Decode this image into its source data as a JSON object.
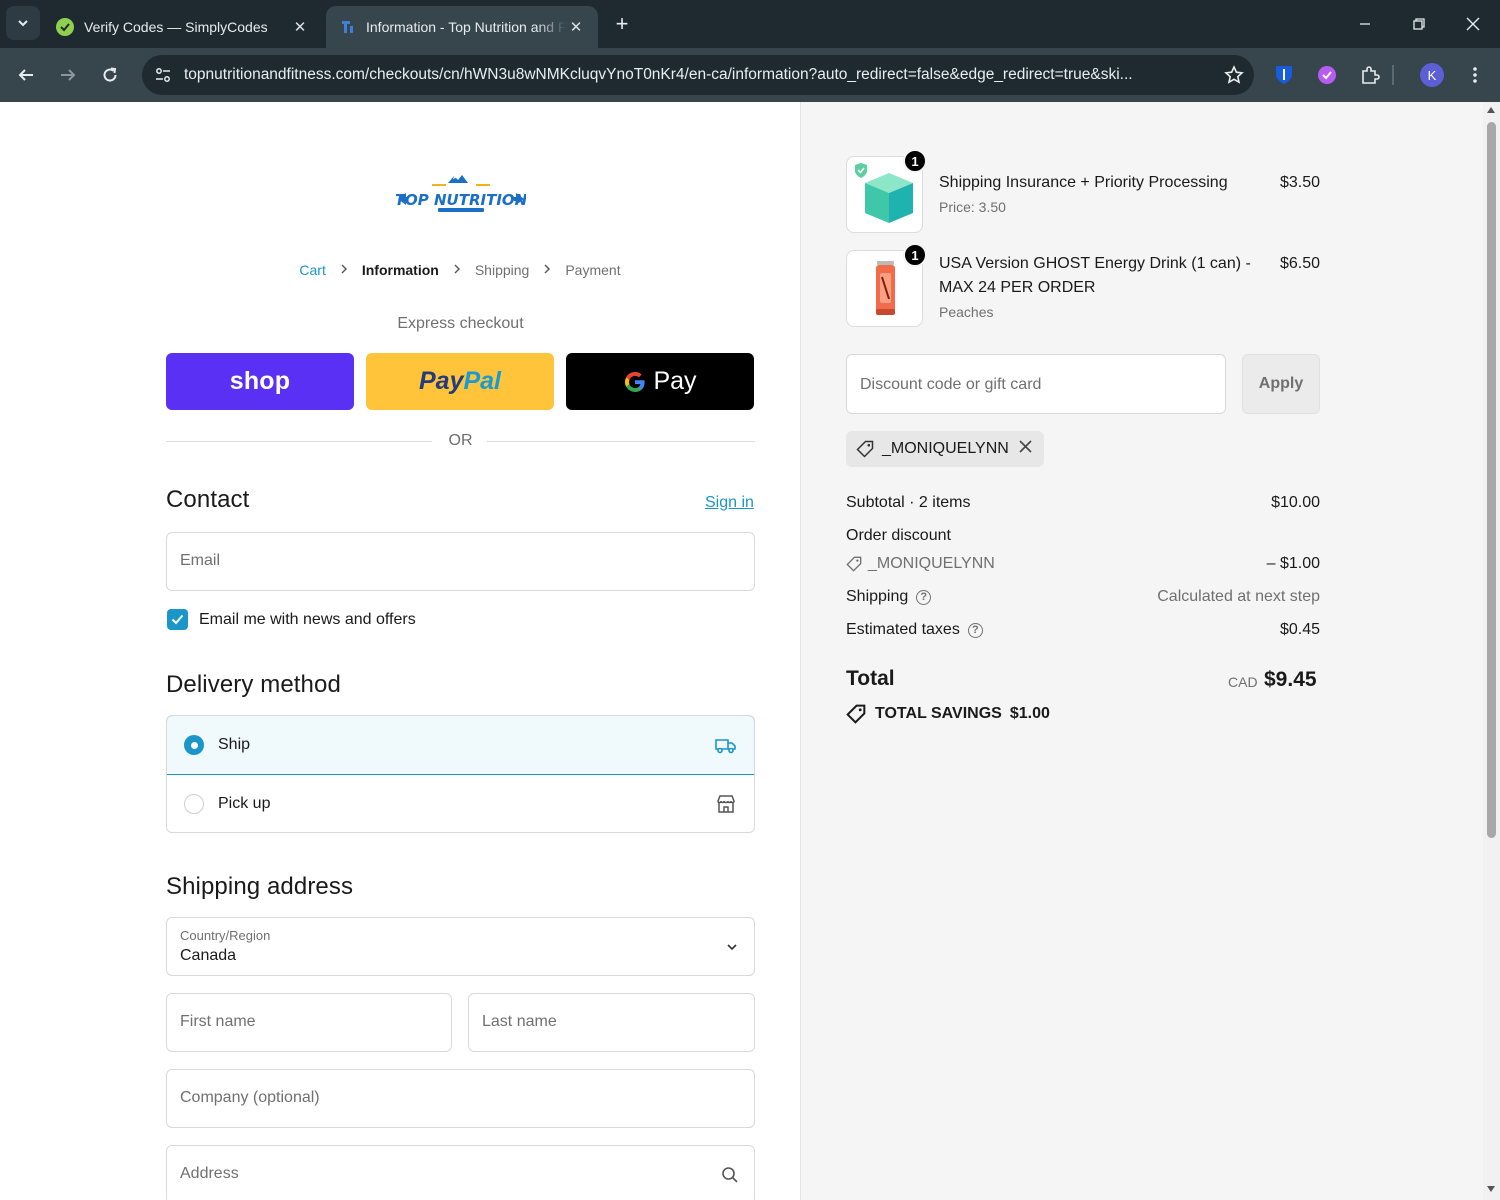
{
  "browser": {
    "tabs": [
      {
        "title": "Verify Codes — SimplyCodes",
        "active": false
      },
      {
        "title": "Information - Top Nutrition and Fitness",
        "active": true
      }
    ],
    "url": "topnutritionandfitness.com/checkouts/cn/hWN3u8wNMKcluqvYnoT0nKr4/en-ca/information?auto_redirect=false&edge_redirect=true&ski...",
    "profile_initial": "K"
  },
  "store": {
    "logo_text": "TOP NUTRITION"
  },
  "breadcrumbs": {
    "cart": "Cart",
    "information": "Information",
    "shipping": "Shipping",
    "payment": "Payment"
  },
  "express": {
    "label": "Express checkout",
    "shop": "shop",
    "paypal_a": "Pay",
    "paypal_b": "Pal",
    "gpay_g": "G",
    "gpay": "Pay",
    "or": "OR"
  },
  "contact": {
    "heading": "Contact",
    "sign_in": "Sign in",
    "email_placeholder": "Email",
    "newsletter_label": "Email me with news and offers",
    "newsletter_checked": true
  },
  "delivery": {
    "heading": "Delivery method",
    "options": [
      {
        "label": "Ship",
        "selected": true,
        "icon": "truck-icon"
      },
      {
        "label": "Pick up",
        "selected": false,
        "icon": "store-icon"
      }
    ]
  },
  "shipping_address": {
    "heading": "Shipping address",
    "country_label": "Country/Region",
    "country_value": "Canada",
    "first_name_placeholder": "First name",
    "last_name_placeholder": "Last name",
    "company_placeholder": "Company (optional)",
    "address_placeholder": "Address"
  },
  "summary": {
    "items": [
      {
        "qty": "1",
        "name": "Shipping Insurance + Priority Processing",
        "sub": "Price: 3.50",
        "price": "$3.50"
      },
      {
        "qty": "1",
        "name_line1": "USA Version GHOST Energy Drink (1 can) -",
        "name_line2": "MAX 24 PER ORDER",
        "sub": "Peaches",
        "price": "$6.50"
      }
    ],
    "discount_placeholder": "Discount code or gift card",
    "apply": "Apply",
    "applied_code": "_MONIQUELYNN",
    "subtotal_label": "Subtotal · 2 items",
    "subtotal": "$10.00",
    "order_discount_label": "Order discount",
    "discount_code": "_MONIQUELYNN",
    "discount_amount": "– $1.00",
    "shipping_label": "Shipping",
    "shipping_value": "Calculated at next step",
    "taxes_label": "Estimated taxes",
    "taxes": "$0.45",
    "total_label": "Total",
    "currency": "CAD",
    "total": "$9.45",
    "savings_label": "TOTAL SAVINGS",
    "savings": "$1.00"
  },
  "colors": {
    "accent": "#1a96c8",
    "shop": "#5a31f4",
    "paypal": "#ffc439",
    "chrome_dark": "#1f2a30",
    "chrome_toolbar": "#37454d"
  }
}
